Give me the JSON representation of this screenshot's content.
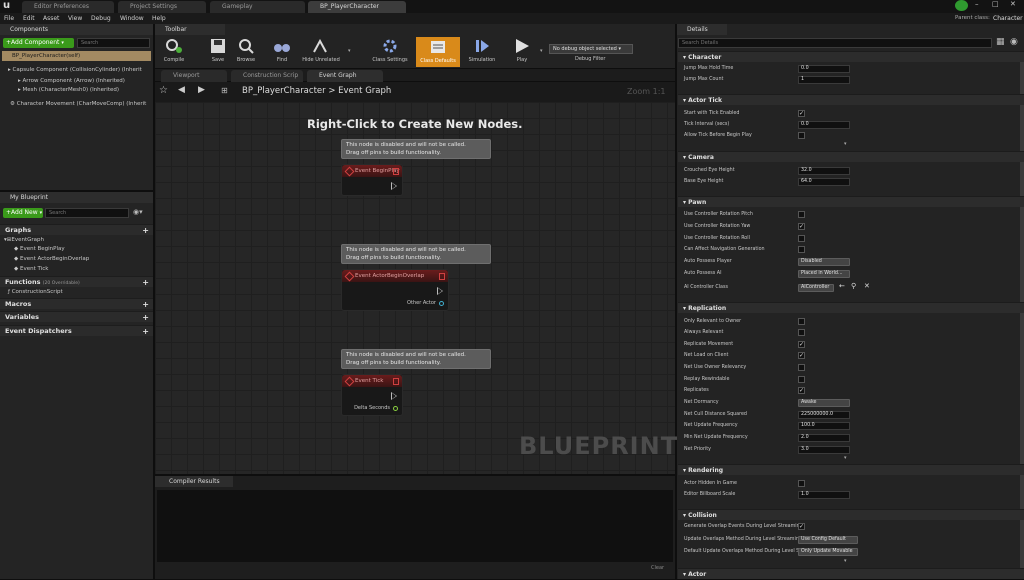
{
  "window": {
    "tabs": [
      "Editor Preferences",
      "Project Settings",
      "Gameplay",
      "BP_PlayerCharacter"
    ],
    "parent_class_label": "Parent class:",
    "parent_class_value": "Character"
  },
  "menu": [
    "File",
    "Edit",
    "Asset",
    "View",
    "Debug",
    "Window",
    "Help"
  ],
  "components": {
    "title": "Components",
    "add_label": "+Add Component",
    "search_placeholder": "Search",
    "items": [
      "BP_PlayerCharacter(self)",
      "Capsule Component (CollisionCylinder) (Inherit",
      "Arrow Component (Arrow) (Inherited)",
      "Mesh (CharacterMesh0) (Inherited)",
      "Character Movement (CharMoveComp) (Inherit"
    ]
  },
  "blueprint": {
    "title": "My Blueprint",
    "add_label": "+Add New",
    "search_placeholder": "Search",
    "graphs_label": "Graphs",
    "event_graph": "EventGraph",
    "events": [
      "Event BeginPlay",
      "Event ActorBeginOverlap",
      "Event Tick"
    ],
    "functions_label": "Functions",
    "functions_count": "(20 Overridable)",
    "construction_script": "ConstructionScript",
    "macros_label": "Macros",
    "variables_label": "Variables",
    "dispatchers_label": "Event Dispatchers"
  },
  "toolbar": {
    "title": "Toolbar",
    "buttons": [
      "Compile",
      "Save",
      "Browse",
      "Find",
      "Hide Unrelated",
      "Class Settings",
      "Class Defaults",
      "Simulation",
      "Play"
    ],
    "debug_object": "No debug object selected",
    "debug_filter": "Debug Filter"
  },
  "graph": {
    "tabs": [
      "Viewport",
      "Construction Scrip",
      "Event Graph"
    ],
    "breadcrumb_root": "BP_PlayerCharacter",
    "breadcrumb_sep": ">",
    "breadcrumb_leaf": "Event Graph",
    "zoom": "Zoom 1:1",
    "hint": "Right-Click to Create New Nodes.",
    "watermark": "BLUEPRINT",
    "note_line1": "This node is disabled and will not be called.",
    "note_line2": "Drag off pins to build functionality.",
    "nodes": [
      {
        "title": "Event BeginPlay",
        "pin": ""
      },
      {
        "title": "Event ActorBeginOverlap",
        "pin": "Other Actor"
      },
      {
        "title": "Event Tick",
        "pin": "Delta Seconds"
      }
    ]
  },
  "compiler": {
    "title": "Compiler Results",
    "clear": "Clear"
  },
  "details": {
    "title": "Details",
    "search_placeholder": "Search Details",
    "character": {
      "label": "Character",
      "rows": [
        {
          "label": "Jump Max Hold Time",
          "value": "0.0"
        },
        {
          "label": "Jump Max Count",
          "value": "1"
        }
      ]
    },
    "actor_tick": {
      "label": "Actor Tick",
      "rows": [
        {
          "label": "Start with Tick Enabled",
          "checked": true
        },
        {
          "label": "Tick Interval (secs)",
          "value": "0.0"
        },
        {
          "label": "Allow Tick Before Begin Play",
          "checked": false
        }
      ]
    },
    "camera": {
      "label": "Camera",
      "rows": [
        {
          "label": "Crouched Eye Height",
          "value": "32.0"
        },
        {
          "label": "Base Eye Height",
          "value": "64.0"
        }
      ]
    },
    "pawn": {
      "label": "Pawn",
      "rows": [
        {
          "label": "Use Controller Rotation Pitch",
          "checked": false
        },
        {
          "label": "Use Controller Rotation Yaw",
          "checked": true
        },
        {
          "label": "Use Controller Rotation Roll",
          "checked": false
        },
        {
          "label": "Can Affect Navigation Generation",
          "checked": false
        },
        {
          "label": "Auto Possess Player",
          "select": "Disabled"
        },
        {
          "label": "Auto Possess AI",
          "select": "Placed in World..."
        },
        {
          "label": "AI Controller Class",
          "select": "AIController"
        }
      ]
    },
    "replication": {
      "label": "Replication",
      "rows": [
        {
          "label": "Only Relevant to Owner",
          "checked": false
        },
        {
          "label": "Always Relevant",
          "checked": false
        },
        {
          "label": "Replicate Movement",
          "checked": true
        },
        {
          "label": "Net Load on Client",
          "checked": true
        },
        {
          "label": "Net Use Owner Relevancy",
          "checked": false
        },
        {
          "label": "Replay Rewindable",
          "checked": false
        },
        {
          "label": "Replicates",
          "checked": true
        },
        {
          "label": "Net Dormancy",
          "select": "Awake"
        },
        {
          "label": "Net Cull Distance Squared",
          "value": "225000000.0"
        },
        {
          "label": "Net Update Frequency",
          "value": "100.0"
        },
        {
          "label": "Min Net Update Frequency",
          "value": "2.0"
        },
        {
          "label": "Net Priority",
          "value": "3.0"
        }
      ]
    },
    "rendering": {
      "label": "Rendering",
      "rows": [
        {
          "label": "Actor Hidden In Game",
          "checked": false
        },
        {
          "label": "Editor Billboard Scale",
          "value": "1.0"
        }
      ]
    },
    "collision": {
      "label": "Collision",
      "rows": [
        {
          "label": "Generate Overlap Events During Level Streaming",
          "checked": true
        },
        {
          "label": "Update Overlaps Method During Level Streaming",
          "select": "Use Config Default"
        },
        {
          "label": "Default Update Overlaps Method During Level St",
          "select": "Only Update Movable"
        }
      ]
    },
    "actor": {
      "label": "Actor"
    }
  },
  "colors": {
    "accent_green": "#3a9a1a",
    "class_defaults_active": "#d98a1a"
  }
}
